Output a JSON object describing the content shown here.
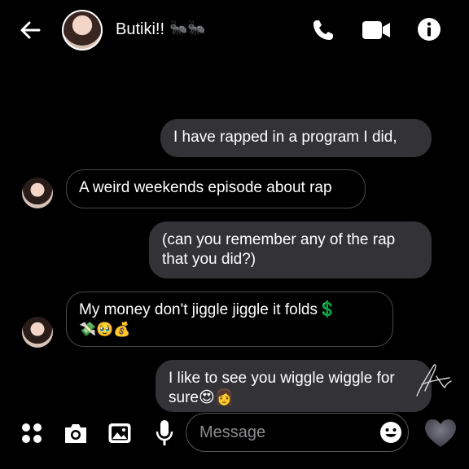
{
  "header": {
    "contact_name": "Butiki!!",
    "contact_emoji": "🐜🐜",
    "back_icon": "arrow-left-icon",
    "call_icon": "phone-icon",
    "video_icon": "video-camera-icon",
    "info_icon": "info-icon"
  },
  "messages": [
    {
      "direction": "sent",
      "text": "I have rapped in a program I did,"
    },
    {
      "direction": "received",
      "text": "A weird weekends episode about rap"
    },
    {
      "direction": "sent",
      "text": "(can you remember any of the rap that you did?)"
    },
    {
      "direction": "received",
      "text": "My money don't jiggle jiggle it folds💲",
      "emoji_line": "💸🥹💰"
    },
    {
      "direction": "sent",
      "text": "I like to see you wiggle wiggle for sure😍👩"
    }
  ],
  "composer": {
    "placeholder": "Message",
    "value": "",
    "icons": [
      "menu-dots-icon",
      "camera-icon",
      "image-icon",
      "microphone-icon",
      "sticker-icon",
      "heart-icon"
    ]
  },
  "colors": {
    "background": "#000000",
    "sent_bubble": "#333337",
    "received_border": "#4a4a4e",
    "placeholder": "#8c8c90",
    "heart": "#5a5a66"
  }
}
